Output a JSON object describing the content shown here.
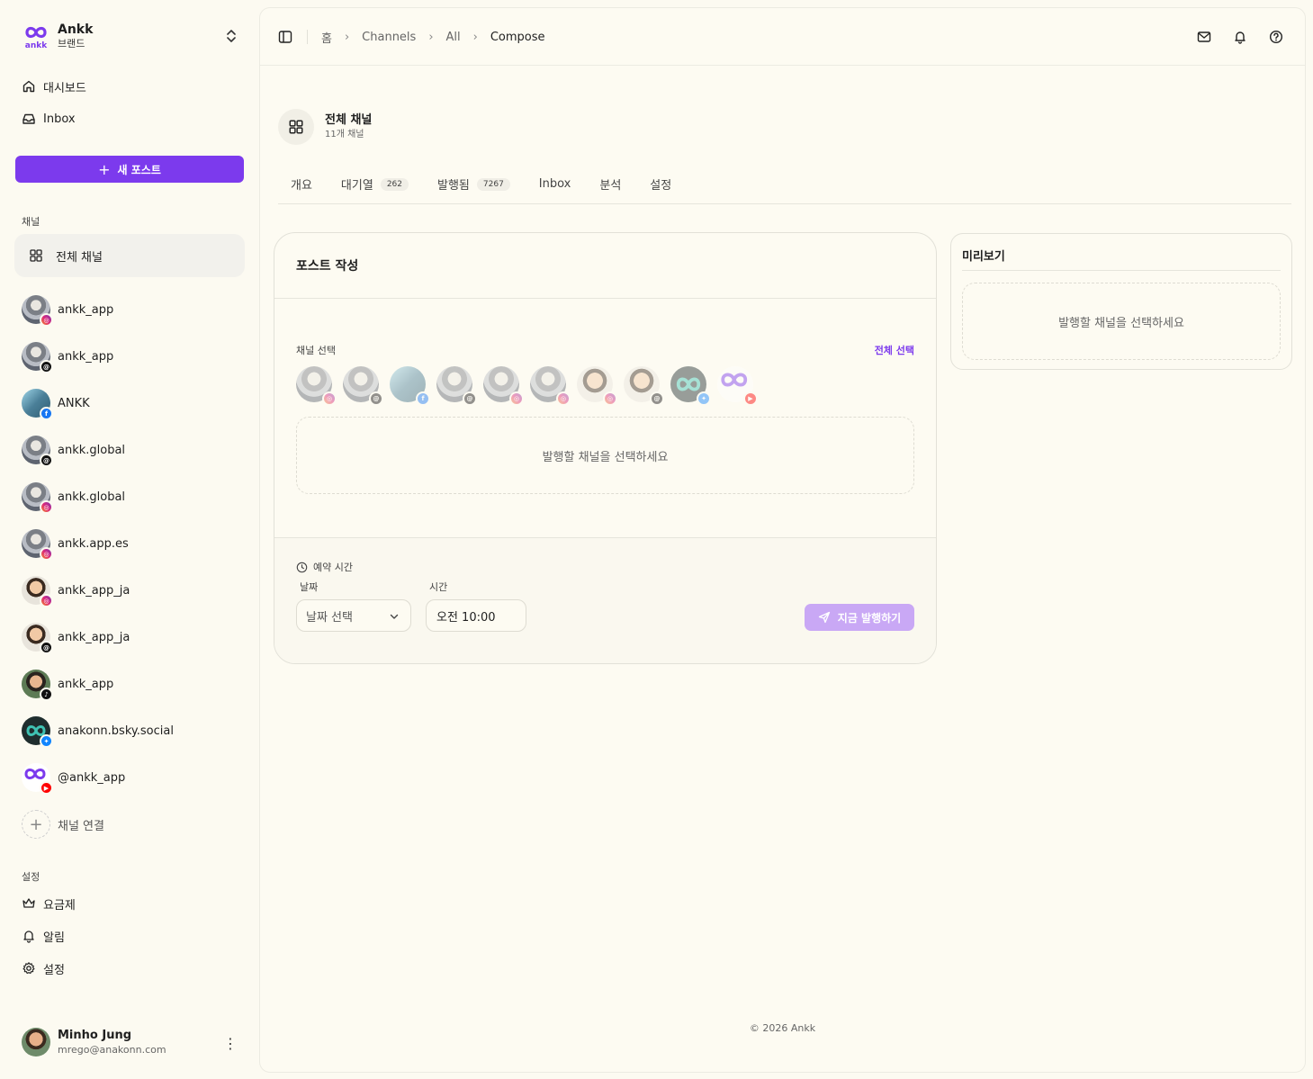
{
  "brand": {
    "name": "Ankk",
    "subtitle": "브랜드",
    "logo_text": "ankk"
  },
  "nav": [
    {
      "label": "대시보드",
      "icon": "home-icon"
    },
    {
      "label": "Inbox",
      "icon": "inbox-icon"
    }
  ],
  "new_post_label": "새 포스트",
  "channels_section_label": "채널",
  "all_channels_label": "전체 채널",
  "channels": [
    {
      "name": "ankk_app",
      "platform": "instagram",
      "avatar": "photo"
    },
    {
      "name": "ankk_app",
      "platform": "threads",
      "avatar": "photo"
    },
    {
      "name": "ANKK",
      "platform": "facebook",
      "avatar": "app"
    },
    {
      "name": "ankk.global",
      "platform": "threads",
      "avatar": "photo"
    },
    {
      "name": "ankk.global",
      "platform": "instagram",
      "avatar": "photo"
    },
    {
      "name": "ankk.app.es",
      "platform": "instagram",
      "avatar": "photo"
    },
    {
      "name": "ankk_app_ja",
      "platform": "instagram",
      "avatar": "face"
    },
    {
      "name": "ankk_app_ja",
      "platform": "threads",
      "avatar": "face"
    },
    {
      "name": "ankk_app",
      "platform": "tiktok",
      "avatar": "kid"
    },
    {
      "name": "anakonn.bsky.social",
      "platform": "bluesky",
      "avatar": "ankk-teal"
    },
    {
      "name": "@ankk_app",
      "platform": "youtube",
      "avatar": "ankk-white"
    }
  ],
  "add_channel_label": "채널 연결",
  "settings_section_label": "설정",
  "settings_nav": [
    {
      "label": "요금제",
      "icon": "crown-icon"
    },
    {
      "label": "알림",
      "icon": "bell-icon"
    },
    {
      "label": "설정",
      "icon": "gear-icon"
    }
  ],
  "user": {
    "name": "Minho Jung",
    "email": "mrego@anakonn.com"
  },
  "breadcrumb": [
    "홈",
    "Channels",
    "All",
    "Compose"
  ],
  "channel_header": {
    "title": "전체 채널",
    "subtitle": "11개 채널"
  },
  "tabs": [
    {
      "label": "개요",
      "count": ""
    },
    {
      "label": "대기열",
      "count": "262"
    },
    {
      "label": "발행됨",
      "count": "7267"
    },
    {
      "label": "Inbox",
      "count": ""
    },
    {
      "label": "분석",
      "count": ""
    },
    {
      "label": "설정",
      "count": ""
    }
  ],
  "composer": {
    "title": "포스트 작성",
    "channel_select_label": "채널 선택",
    "select_all_label": "전체 선택",
    "empty_message": "발행할 채널을 선택하세요",
    "schedule_label": "예약 시간",
    "date_label": "날짜",
    "time_label": "시간",
    "date_placeholder": "날짜 선택",
    "time_value": "오전 10:00",
    "publish_label": "지금 발행하기"
  },
  "preview": {
    "title": "미리보기",
    "empty_message": "발행할 채널을 선택하세요"
  },
  "footer": "© 2026 Ankk",
  "colors": {
    "accent": "#7c3aed",
    "accent_disabled": "#c9a8f5",
    "background": "#fcfaf1"
  }
}
